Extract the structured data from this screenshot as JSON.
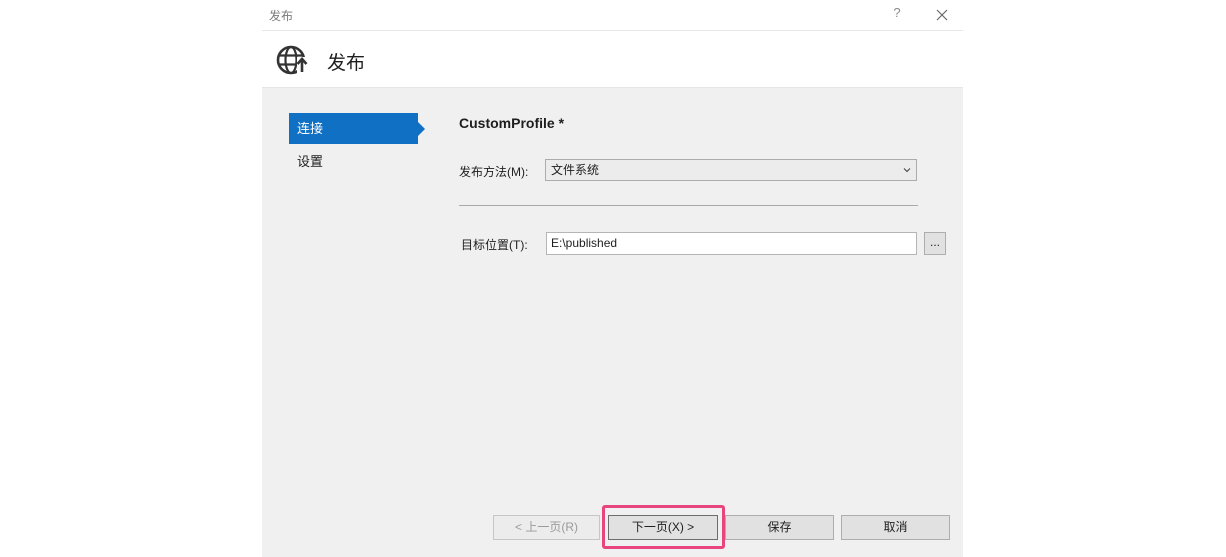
{
  "window": {
    "title": "发布",
    "help_label": "?",
    "close_icon": "close-icon"
  },
  "header": {
    "icon": "globe-publish-icon",
    "title": "发布"
  },
  "sidebar": {
    "items": [
      {
        "label": "连接",
        "active": true
      },
      {
        "label": "设置",
        "active": false
      }
    ]
  },
  "main": {
    "profile_title": "CustomProfile *",
    "publish_method": {
      "label": "发布方法(M):",
      "value": "文件系统"
    },
    "target_location": {
      "label": "目标位置(T):",
      "value": "E:\\published",
      "browse_label": "..."
    }
  },
  "footer": {
    "prev_label": "< 上一页(R)",
    "next_label": "下一页(X) >",
    "save_label": "保存",
    "cancel_label": "取消"
  },
  "colors": {
    "accent": "#1070c4",
    "highlight": "#e8457f",
    "background": "#f0f0f0"
  }
}
